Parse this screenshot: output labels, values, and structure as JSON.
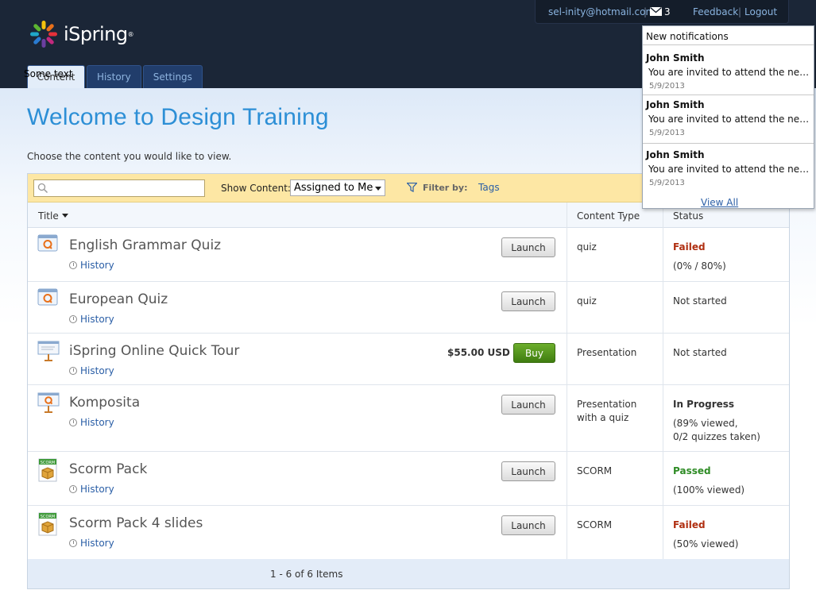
{
  "app": {
    "brand": "iSpring"
  },
  "topbar": {
    "email": "sel-inity@hotmail.com",
    "separator": "|",
    "mail_count": "3",
    "feedback": "Feedback",
    "logout": "Logout"
  },
  "tabs": [
    {
      "label": "Content"
    },
    {
      "label": "History"
    },
    {
      "label": "Settings"
    }
  ],
  "tab_overlay": "Some text",
  "main": {
    "title": "Welcome to Design Training",
    "subtitle": "Choose the content you would like to view."
  },
  "filter": {
    "search_placeholder": "",
    "show_content_label": "Show Content:",
    "show_content_value": "Assigned to Me",
    "filter_by_label": "Filter by:",
    "tags_link": "Tags"
  },
  "table": {
    "columns": {
      "title": "Title",
      "content_type": "Content Type",
      "status": "Status"
    },
    "rows": [
      {
        "title": "English Grammar Quiz",
        "history": "History",
        "action": "Launch",
        "content_type": "quiz",
        "status": "Failed",
        "status_detail": "(0% / 80%)"
      },
      {
        "title": "European Quiz",
        "history": "History",
        "action": "Launch",
        "content_type": "quiz",
        "status": "Not started",
        "status_detail": ""
      },
      {
        "title": "iSpring Online Quick Tour",
        "history": "History",
        "action": "Buy",
        "price": "$55.00 USD",
        "content_type": "Presentation",
        "status": "Not started",
        "status_detail": ""
      },
      {
        "title": "Komposita",
        "history": "History",
        "action": "Launch",
        "content_type": "Presentation with a quiz",
        "status": "In Progress",
        "status_detail_line1": "(89% viewed,",
        "status_detail_line2": "0/2 quizzes taken)"
      },
      {
        "title": "Scorm Pack",
        "history": "History",
        "action": "Launch",
        "content_type": "SCORM",
        "status": "Passed",
        "status_detail": "(100% viewed)"
      },
      {
        "title": "Scorm Pack 4 slides",
        "history": "History",
        "action": "Launch",
        "content_type": "SCORM",
        "status": "Failed",
        "status_detail": "(50% viewed)"
      }
    ],
    "pager": "1 - 6 of 6 Items"
  },
  "notifications": {
    "header": "New notifications",
    "items": [
      {
        "name": "John Smith",
        "text": "You are invited to attend the new ...",
        "date": "5/9/2013"
      },
      {
        "name": "John Smith",
        "text": "You are invited to attend the new ...",
        "date": "5/9/2013"
      },
      {
        "name": "John Smith",
        "text": "You are invited to attend the new ...",
        "date": "5/9/2013"
      }
    ],
    "view_all": "View All"
  },
  "colors": {
    "header_bg": "#1b2637",
    "accent_title": "#2d8fd6",
    "link": "#2a5ea6",
    "failed": "#b02e10",
    "passed": "#2f8c26",
    "buy": "#4f9a1c",
    "filter_bar": "#fde7a4"
  },
  "icons": {
    "quiz": "quiz-icon",
    "presentation": "presentation-icon",
    "scorm": "scorm-icon",
    "mail": "mail-icon",
    "search": "search-icon",
    "filter": "filter-icon",
    "clock": "clock-icon"
  }
}
